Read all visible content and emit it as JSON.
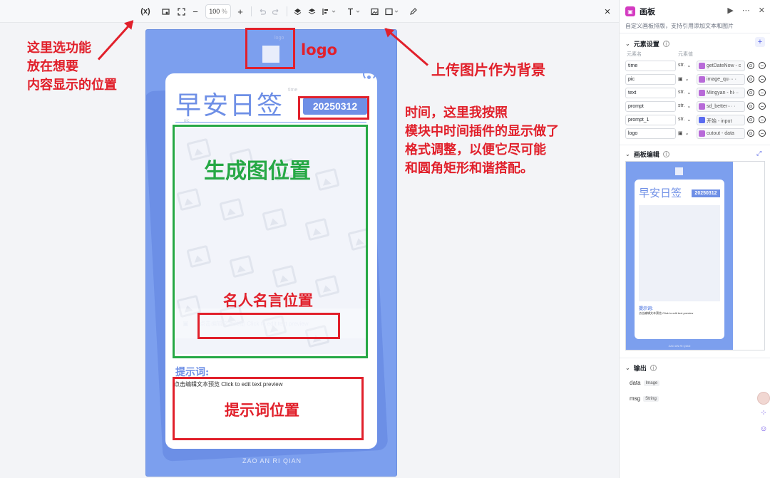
{
  "toolbar": {
    "variable_btn": "(x)",
    "zoom_value": "100",
    "zoom_unit": "%",
    "zoom_out": "−",
    "zoom_in": "+",
    "close": "×"
  },
  "poster": {
    "logo_label": "logo",
    "title": "早安日签",
    "title_label": "time",
    "date": "20250312",
    "pic_label": "pic",
    "quote_text": "点击编辑文本预览 Click to edit text preview",
    "prompt_label": "提示词:",
    "prompt_text": "点击编辑文本预览 Click to edit text preview",
    "footer": "ZAO AN RI QIAN"
  },
  "annotations": {
    "select_hint": "这里选功能\n放在想要\n内容显示的位置",
    "logo": "logo",
    "upload_bg": "上传图片作为背景",
    "time_note": "时间，这里我按照\n模块中时间插件的显示做了\n格式调整，以便它尽可能\n和圆角矩形和谐搭配。",
    "gen_image": "生成图位置",
    "quote_pos": "名人名言位置",
    "prompt_pos": "提示词位置"
  },
  "panel": {
    "title": "画板",
    "description": "自定义画板排版，支持引用添加文本和图片",
    "elements_section": "元素设置",
    "col_name": "元素名",
    "col_value": "元素值",
    "add": "+",
    "rows": [
      {
        "name": "time",
        "type": "str.",
        "value": "getDateNow - c",
        "icon": "plugin-icon"
      },
      {
        "name": "pic",
        "type": "img",
        "value": "image_qu··· ·",
        "icon": "plugin-icon"
      },
      {
        "name": "text",
        "type": "str.",
        "value": "Mingyan - hi···",
        "icon": "plugin-icon"
      },
      {
        "name": "prompt",
        "type": "str.",
        "value": "sd_better··· ·",
        "icon": "plugin-icon"
      },
      {
        "name": "prompt_1",
        "type": "str.",
        "value": "开始 - input",
        "icon": "start-icon"
      },
      {
        "name": "logo",
        "type": "img",
        "value": "cutout - data",
        "icon": "plugin-icon"
      }
    ],
    "canvas_section": "画板编辑",
    "mini": {
      "title": "早安日签",
      "date": "20250312",
      "prompt_label": "提示词:",
      "prompt_text": "点击编辑文本预览 Click to edit text preview",
      "footer": "ZAO AN RI QIAN"
    },
    "output_section": "输出",
    "outputs": [
      {
        "name": "data",
        "type": "Image"
      },
      {
        "name": "msg",
        "type": "String"
      }
    ]
  },
  "colors": {
    "poster_blue": "#7c9fee",
    "annotation_red": "#e1202b",
    "annotation_green": "#26a845"
  }
}
